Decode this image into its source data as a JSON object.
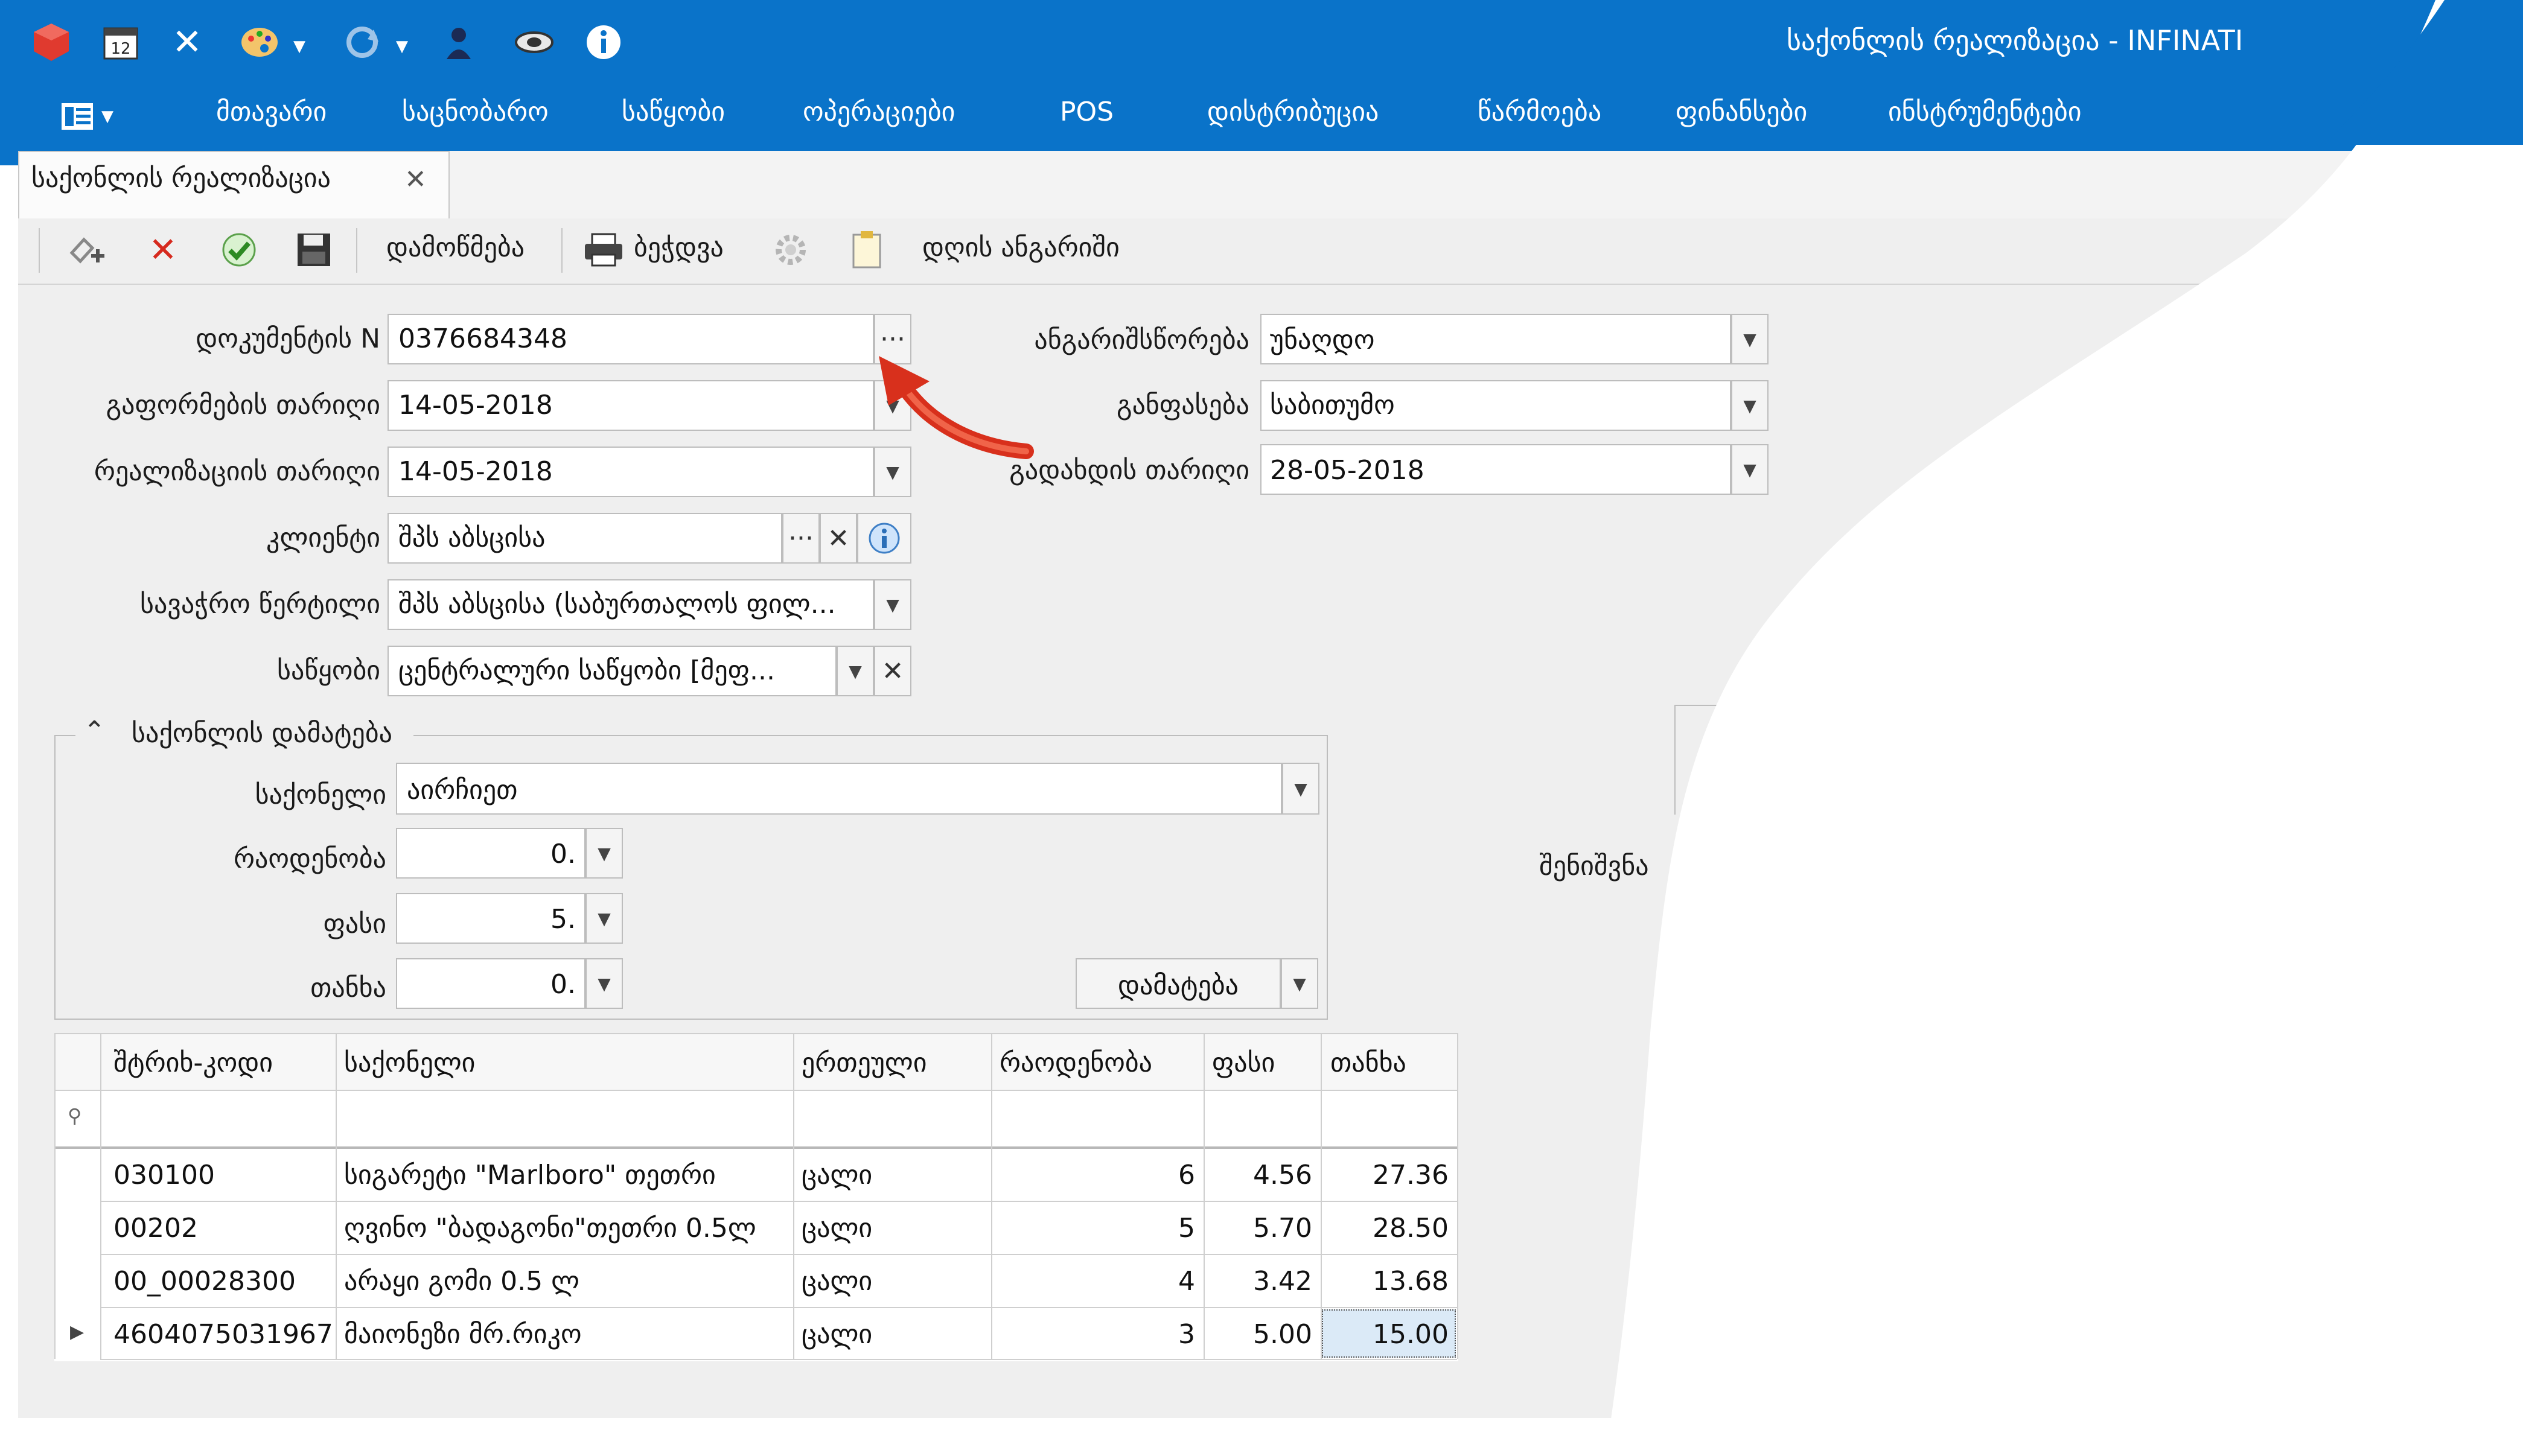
{
  "window": {
    "title": "საქონლის რეალიზაცია - INFINATI",
    "accent_color": "#0a73c9",
    "quick_access_icons": [
      "app-cube-icon",
      "calendar-icon",
      "tools-icon",
      "palette-icon",
      "sync-icon",
      "user-icon",
      "handshake-icon",
      "info-icon"
    ],
    "calendar_day": "12"
  },
  "menu": {
    "layout_button_icon": "layout-icon",
    "items": [
      "მთავარი",
      "საცნობარო",
      "საწყობი",
      "ოპერაციები",
      "POS",
      "დისტრიბუცია",
      "წარმოება",
      "ფინანსები",
      "ინსტრუმენტები"
    ]
  },
  "tab": {
    "label": "საქონლის რეალიზაცია",
    "close": "✕"
  },
  "toolbar": {
    "confirm_label": "დამოწმება",
    "print_label": "ბეჭდვა",
    "daily_report_label": "დღის ანგარიში"
  },
  "form": {
    "doc_number_label": "დოკუმენტის N",
    "doc_number": "0376684348",
    "issue_date_label": "გაფორმების თარიღი",
    "issue_date": "14-05-2018",
    "realization_date_label": "რეალიზაციის თარიღი",
    "realization_date": "14-05-2018",
    "client_label": "კლიენტი",
    "client": "შპს აბსცისა",
    "trade_point_label": "სავაჭრო წერტილი",
    "trade_point": "შპს აბსცისა (საბურთალოს ფილ...",
    "warehouse_label": "საწყობი",
    "warehouse": "ცენტრალური საწყობი  [მეფ...",
    "settlement_label": "ანგარიშსწორება",
    "settlement": "უნაღდო",
    "pricing_label": "განფასება",
    "pricing": "საბითუმო",
    "payment_date_label": "გადახდის თარიღი",
    "payment_date": "28-05-2018",
    "notes_label": "შენიშვნა"
  },
  "add_goods": {
    "title": "საქონლის დამატება",
    "goods_label": "საქონელი",
    "goods": "აირჩიეთ",
    "quantity_label": "რაოდენობა",
    "quantity": "0.",
    "price_label": "ფასი",
    "price": "5.",
    "amount_label": "თანხა",
    "amount": "0.",
    "add_button": "დამატება"
  },
  "grid": {
    "columns": [
      "შტრიხ-კოდი",
      "საქონელი",
      "ერთეული",
      "რაოდენობა",
      "ფასი",
      "თანხა"
    ],
    "rows": [
      {
        "barcode": "030100",
        "goods": "სიგარეტი \"Marlboro\" თეთრი",
        "unit": "ცალი",
        "qty": "6",
        "price": "4.56",
        "amount": "27.36"
      },
      {
        "barcode": "00202",
        "goods": "ღვინო \"ბადაგონი\"თეთრი 0.5ლ",
        "unit": "ცალი",
        "qty": "5",
        "price": "5.70",
        "amount": "28.50"
      },
      {
        "barcode": "00_00028300",
        "goods": "არაყი გომი 0.5 ლ",
        "unit": "ცალი",
        "qty": "4",
        "price": "3.42",
        "amount": "13.68"
      },
      {
        "barcode": "4604075031967",
        "goods": "მაიონეზი მრ.რიკო",
        "unit": "ცალი",
        "qty": "3",
        "price": "5.00",
        "amount": "15.00"
      }
    ]
  }
}
